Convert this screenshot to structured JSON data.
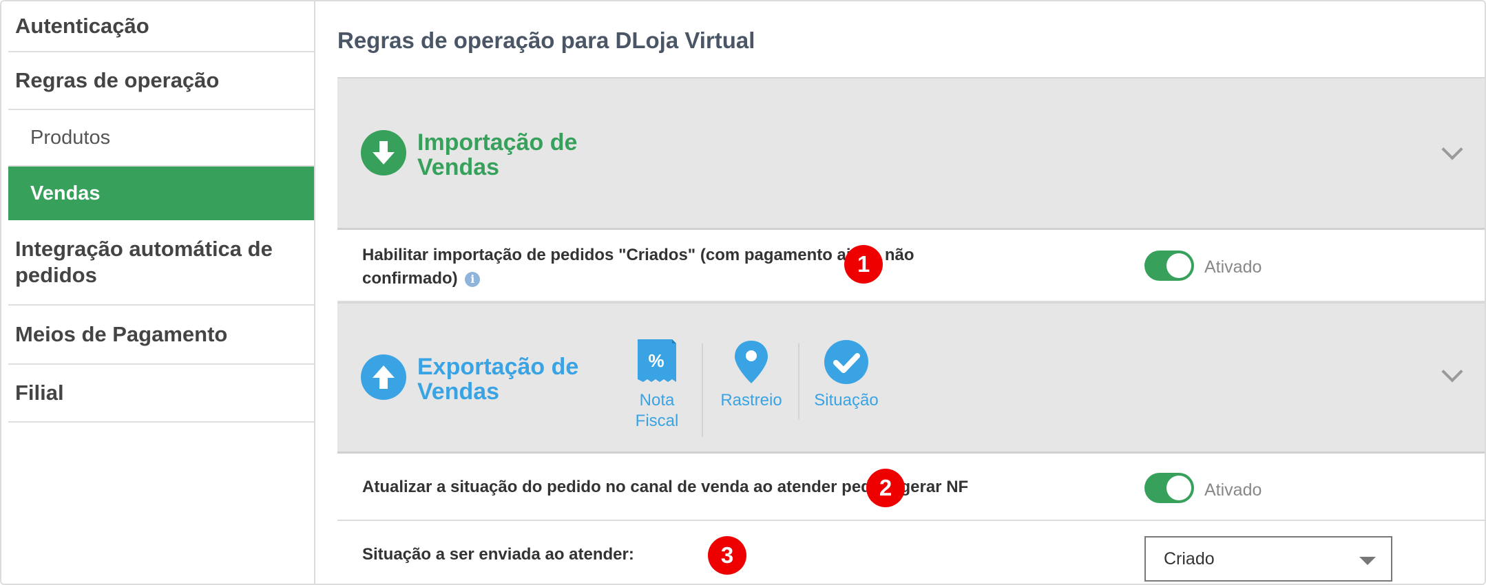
{
  "sidebar": {
    "items": [
      {
        "label": "Autenticação"
      },
      {
        "label": "Regras de operação"
      },
      {
        "label": "Produtos"
      },
      {
        "label": "Vendas"
      },
      {
        "label": "Integração automática de pedidos"
      },
      {
        "label": "Meios de Pagamento"
      },
      {
        "label": "Filial"
      }
    ]
  },
  "main": {
    "title": "Regras de operação para DLoja Virtual",
    "import_section": {
      "title_line1": "Importação de",
      "title_line2": "Vendas",
      "icon": "arrow-down-circle-icon",
      "color": "#37a15c"
    },
    "import_row": {
      "text_line1": "Habilitar importação de pedidos \"Criados\" (com pagamento ainda não",
      "text_line2": "confirmado)",
      "badge": "1",
      "toggle_label": "Ativado",
      "toggle_on": true
    },
    "export_section": {
      "title_line1": "Exportação de",
      "title_line2": "Vendas",
      "icon": "arrow-up-circle-icon",
      "color": "#3aa3e3",
      "tools": [
        {
          "label_line1": "Nota",
          "label_line2": "Fiscal",
          "icon": "invoice-percent-icon"
        },
        {
          "label_line1": "Rastreio",
          "label_line2": "",
          "icon": "map-pin-icon"
        },
        {
          "label_line1": "Situação",
          "label_line2": "",
          "icon": "check-circle-icon"
        }
      ]
    },
    "update_row": {
      "text": "Atualizar a situação do pedido no canal de venda ao atender pedido/gerar NF",
      "badge": "2",
      "toggle_label": "Ativado",
      "toggle_on": true
    },
    "status_row": {
      "text": "Situação a ser enviada ao atender:",
      "badge": "3",
      "select_value": "Criado"
    }
  },
  "colors": {
    "accent_green": "#37a15c",
    "accent_blue": "#3aa3e3",
    "badge_red": "#ee0000"
  }
}
